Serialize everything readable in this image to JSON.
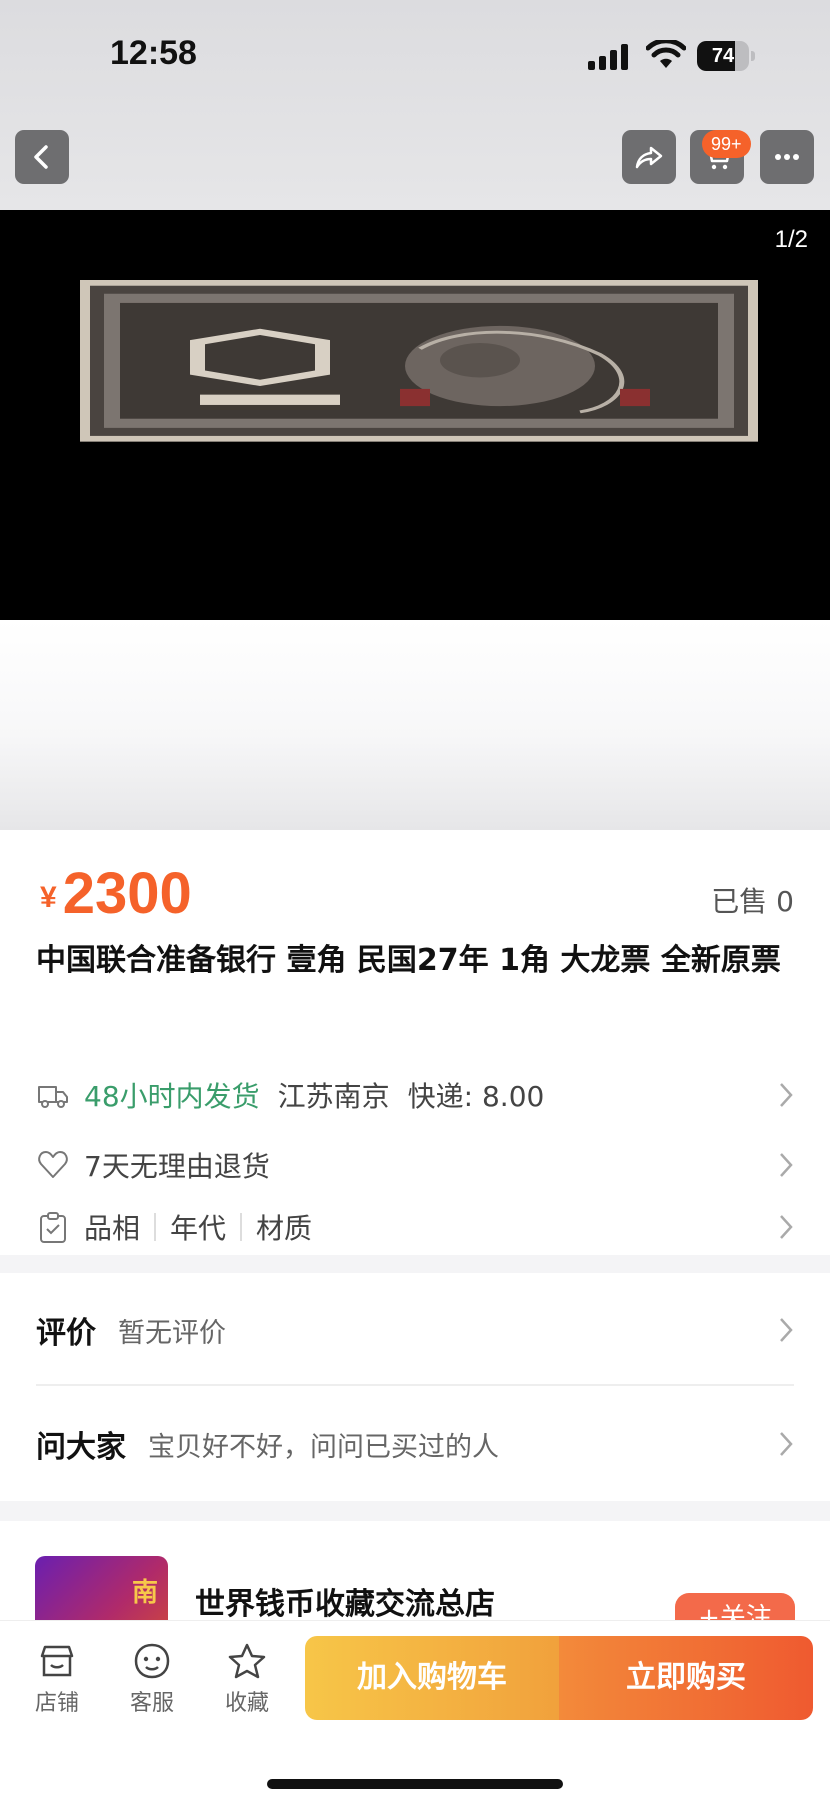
{
  "status_bar": {
    "time": "12:58",
    "battery_percent": 74,
    "battery_label": "74"
  },
  "nav": {
    "cart_badge": "99+"
  },
  "gallery": {
    "counter": "1/2"
  },
  "product": {
    "currency": "¥",
    "price": "2300",
    "sold": "已售 0",
    "title": "中国联合准备银行 壹角 民国27年 1角 大龙票 全新原票",
    "shipping_time": "48小时内发货",
    "location": "江苏南京",
    "shipping_fee": "快递: 8.00",
    "return_policy": "7天无理由退货",
    "attributes": [
      "品相",
      "年代",
      "材质"
    ]
  },
  "reviews": {
    "label": "评价",
    "value": "暂无评价",
    "ask_label": "问大家",
    "ask_hint": "宝贝好不好，问问已买过的人"
  },
  "shop": {
    "name": "世界钱币收藏交流总店",
    "follow_label": "+关注",
    "logo_text": "南"
  },
  "bottom_bar": {
    "store": "店铺",
    "service": "客服",
    "favorite": "收藏",
    "add_to_cart": "加入购物车",
    "buy_now": "立即购买"
  },
  "icons": [
    "back-icon",
    "share-icon",
    "cart-icon",
    "more-icon",
    "truck-icon",
    "heart-icon",
    "clipboard-icon",
    "store-icon",
    "service-icon",
    "star-icon"
  ],
  "colors": {
    "accent": "#f5622a",
    "green": "#3a9d6b",
    "cart_button": "#f7c648",
    "buy_button": "#ef5a30"
  }
}
